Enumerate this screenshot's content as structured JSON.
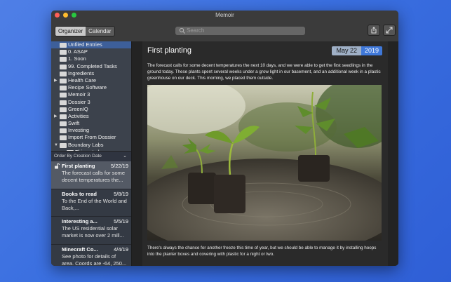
{
  "window": {
    "title": "Memoir"
  },
  "toolbar": {
    "tabs": [
      {
        "label": "Organizer"
      },
      {
        "label": "Calendar"
      }
    ],
    "search_placeholder": "Search"
  },
  "folders": [
    {
      "label": "Unfiled Entries",
      "indent": 0,
      "expandable": false,
      "selected": true
    },
    {
      "label": "0. ASAP",
      "indent": 0,
      "expandable": false
    },
    {
      "label": "1. Soon",
      "indent": 0,
      "expandable": false
    },
    {
      "label": "99. Completed Tasks",
      "indent": 0,
      "expandable": false
    },
    {
      "label": "Ingredients",
      "indent": 0,
      "expandable": false
    },
    {
      "label": "Health Care",
      "indent": 0,
      "expandable": true
    },
    {
      "label": "Recipe Software",
      "indent": 0,
      "expandable": false
    },
    {
      "label": "Memoir 3",
      "indent": 0,
      "expandable": false
    },
    {
      "label": "Dossier 3",
      "indent": 0,
      "expandable": false
    },
    {
      "label": "GreenIQ",
      "indent": 0,
      "expandable": false
    },
    {
      "label": "Activities",
      "indent": 0,
      "expandable": true
    },
    {
      "label": "Swift",
      "indent": 0,
      "expandable": false
    },
    {
      "label": "Investing",
      "indent": 0,
      "expandable": false
    },
    {
      "label": "Import From Dossier",
      "indent": 0,
      "expandable": false
    },
    {
      "label": "Boundary Labs",
      "indent": 0,
      "expandable": true,
      "expanded": true
    },
    {
      "label": "Things to learn",
      "indent": 1,
      "expandable": false
    }
  ],
  "order": {
    "label": "Order By Creation Date"
  },
  "notes": [
    {
      "title": "First planting",
      "date": "5/22/19",
      "preview": "The forecast calls for some decent temperatures the...",
      "selected": true
    },
    {
      "title": "Books to read",
      "date": "5/8/19",
      "preview": "To the End of the World and Back,..."
    },
    {
      "title": "Interesting a...",
      "date": "5/5/19",
      "preview": "The US residential solar market is now over 2 mill..."
    },
    {
      "title": "Minecraft Co...",
      "date": "4/4/19",
      "preview": "See photo for details of area. Coords are -64, 250..."
    }
  ],
  "entry": {
    "title": "First planting",
    "date_day": "May 22",
    "date_year": "2019",
    "paragraph1": "The forecast calls for some decent temperatures the next 10 days, and we were able to get the first seedlings in the ground today. These plants spent several weeks under a grow light in our basement, and an additional week in a plastic greenhouse on our deck. This morning, we placed them outside.",
    "paragraph2": "There's always the chance for another freeze this time of year, but we should be able to manage it by installing hoops into the planter boxes and covering with plastic for a night or two."
  },
  "colors": {
    "background": "#3a6fe0",
    "accent": "#3f78d9",
    "selection": "#3d5f9a"
  }
}
